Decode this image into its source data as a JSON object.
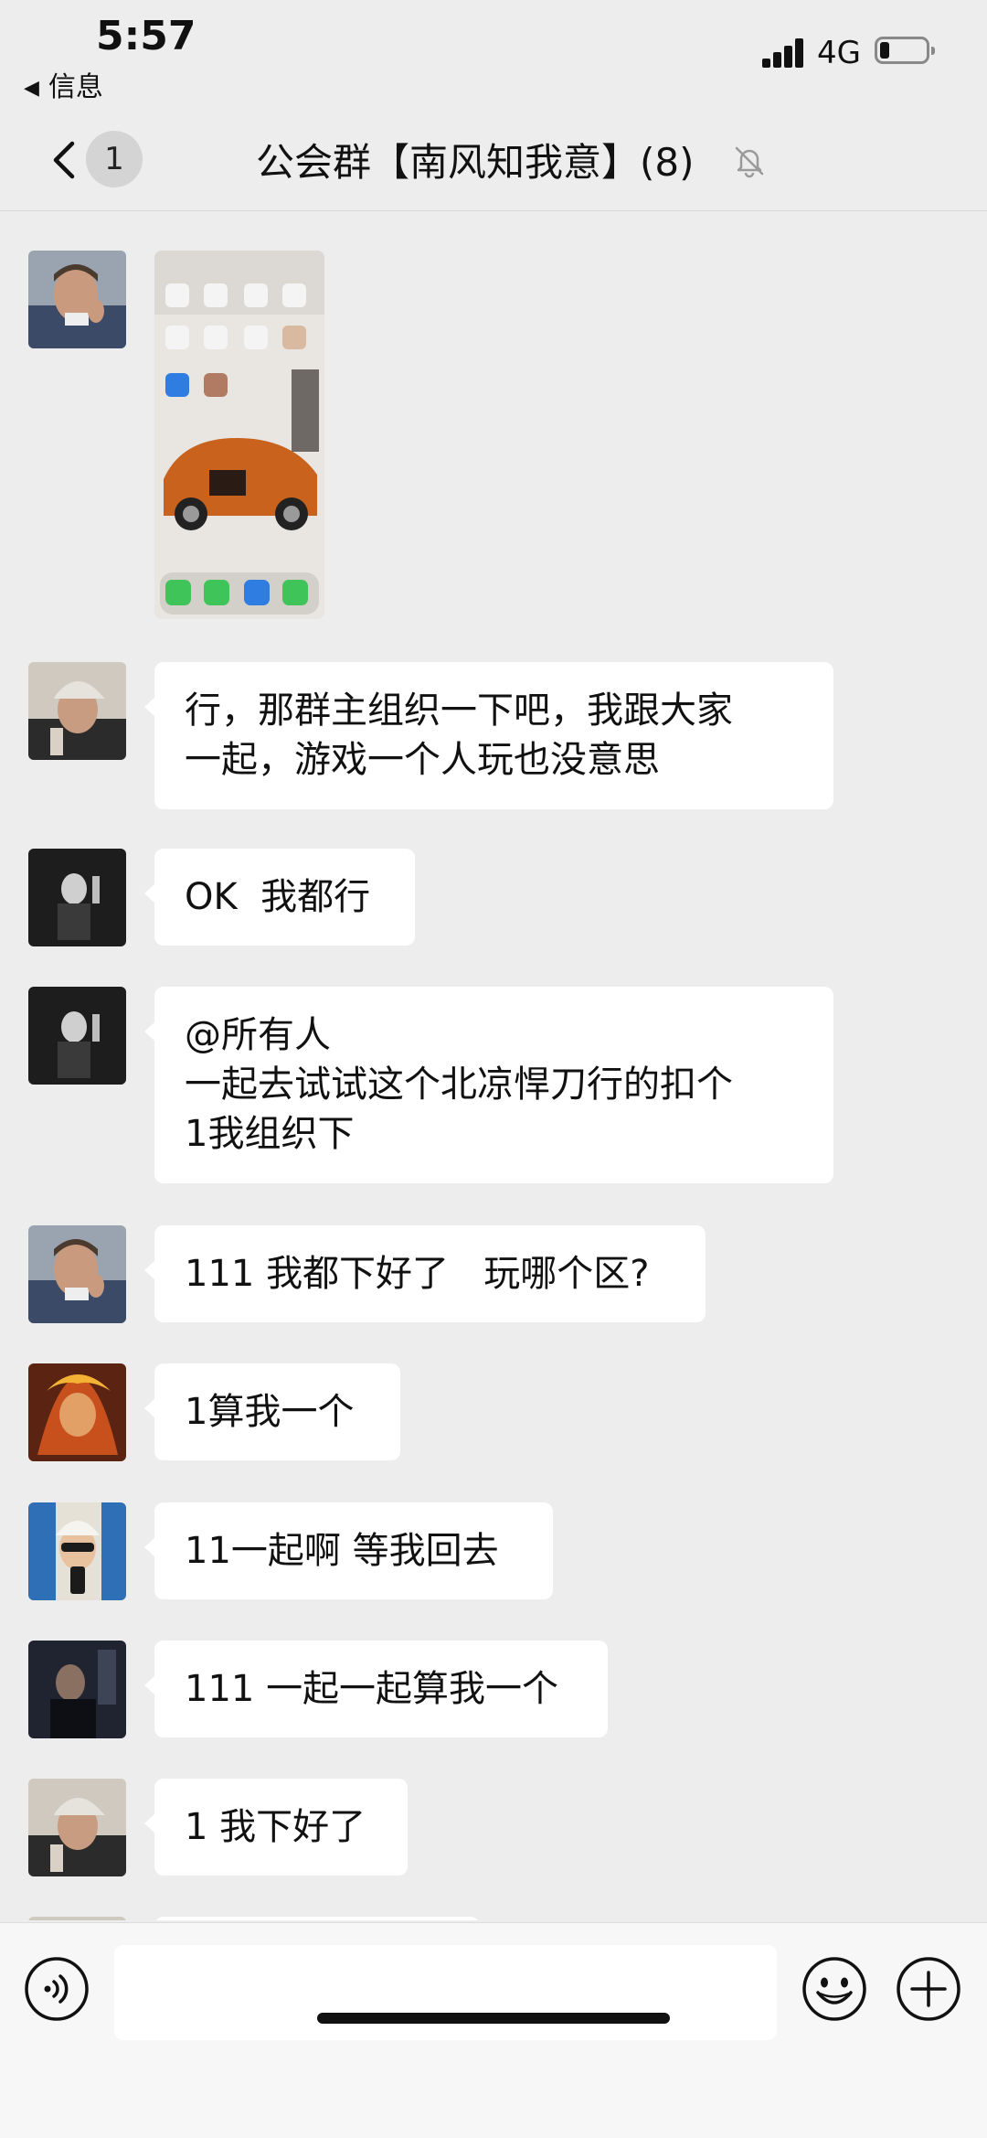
{
  "status_bar": {
    "time": "5:57",
    "back_app": "信息",
    "network": "4G"
  },
  "nav": {
    "unread_count": "1",
    "title": "公会群【南风知我意】(8)"
  },
  "messages": [
    {
      "type": "image",
      "avatar": "avatar-suit-man"
    },
    {
      "type": "text",
      "avatar": "avatar-cap-man",
      "text": "行，那群主组织一下吧，我跟大家\n一起，游戏一个人玩也没意思"
    },
    {
      "type": "text",
      "avatar": "avatar-bw-boy",
      "text": "OK  我都行"
    },
    {
      "type": "text",
      "avatar": "avatar-bw-boy",
      "text": "@所有人\n一起去试试这个北凉悍刀行的扣个\n1我组织下"
    },
    {
      "type": "text",
      "avatar": "avatar-suit-man",
      "text": "111 我都下好了   玩哪个区?"
    },
    {
      "type": "text",
      "avatar": "avatar-fire-warrior",
      "text": "1算我一个"
    },
    {
      "type": "text",
      "avatar": "avatar-hat-selfie",
      "text": "11一起啊 等我回去"
    },
    {
      "type": "text",
      "avatar": "avatar-dark-man",
      "text": "111 一起一起算我一个"
    },
    {
      "type": "text",
      "avatar": "avatar-cap-man",
      "text": "1 我下好了"
    }
  ],
  "input": {
    "value": ""
  },
  "icons": {
    "back": "chevron-left-icon",
    "mute": "bell-off-icon",
    "voice": "voice-icon",
    "emoji": "emoji-icon",
    "plus": "plus-icon"
  }
}
